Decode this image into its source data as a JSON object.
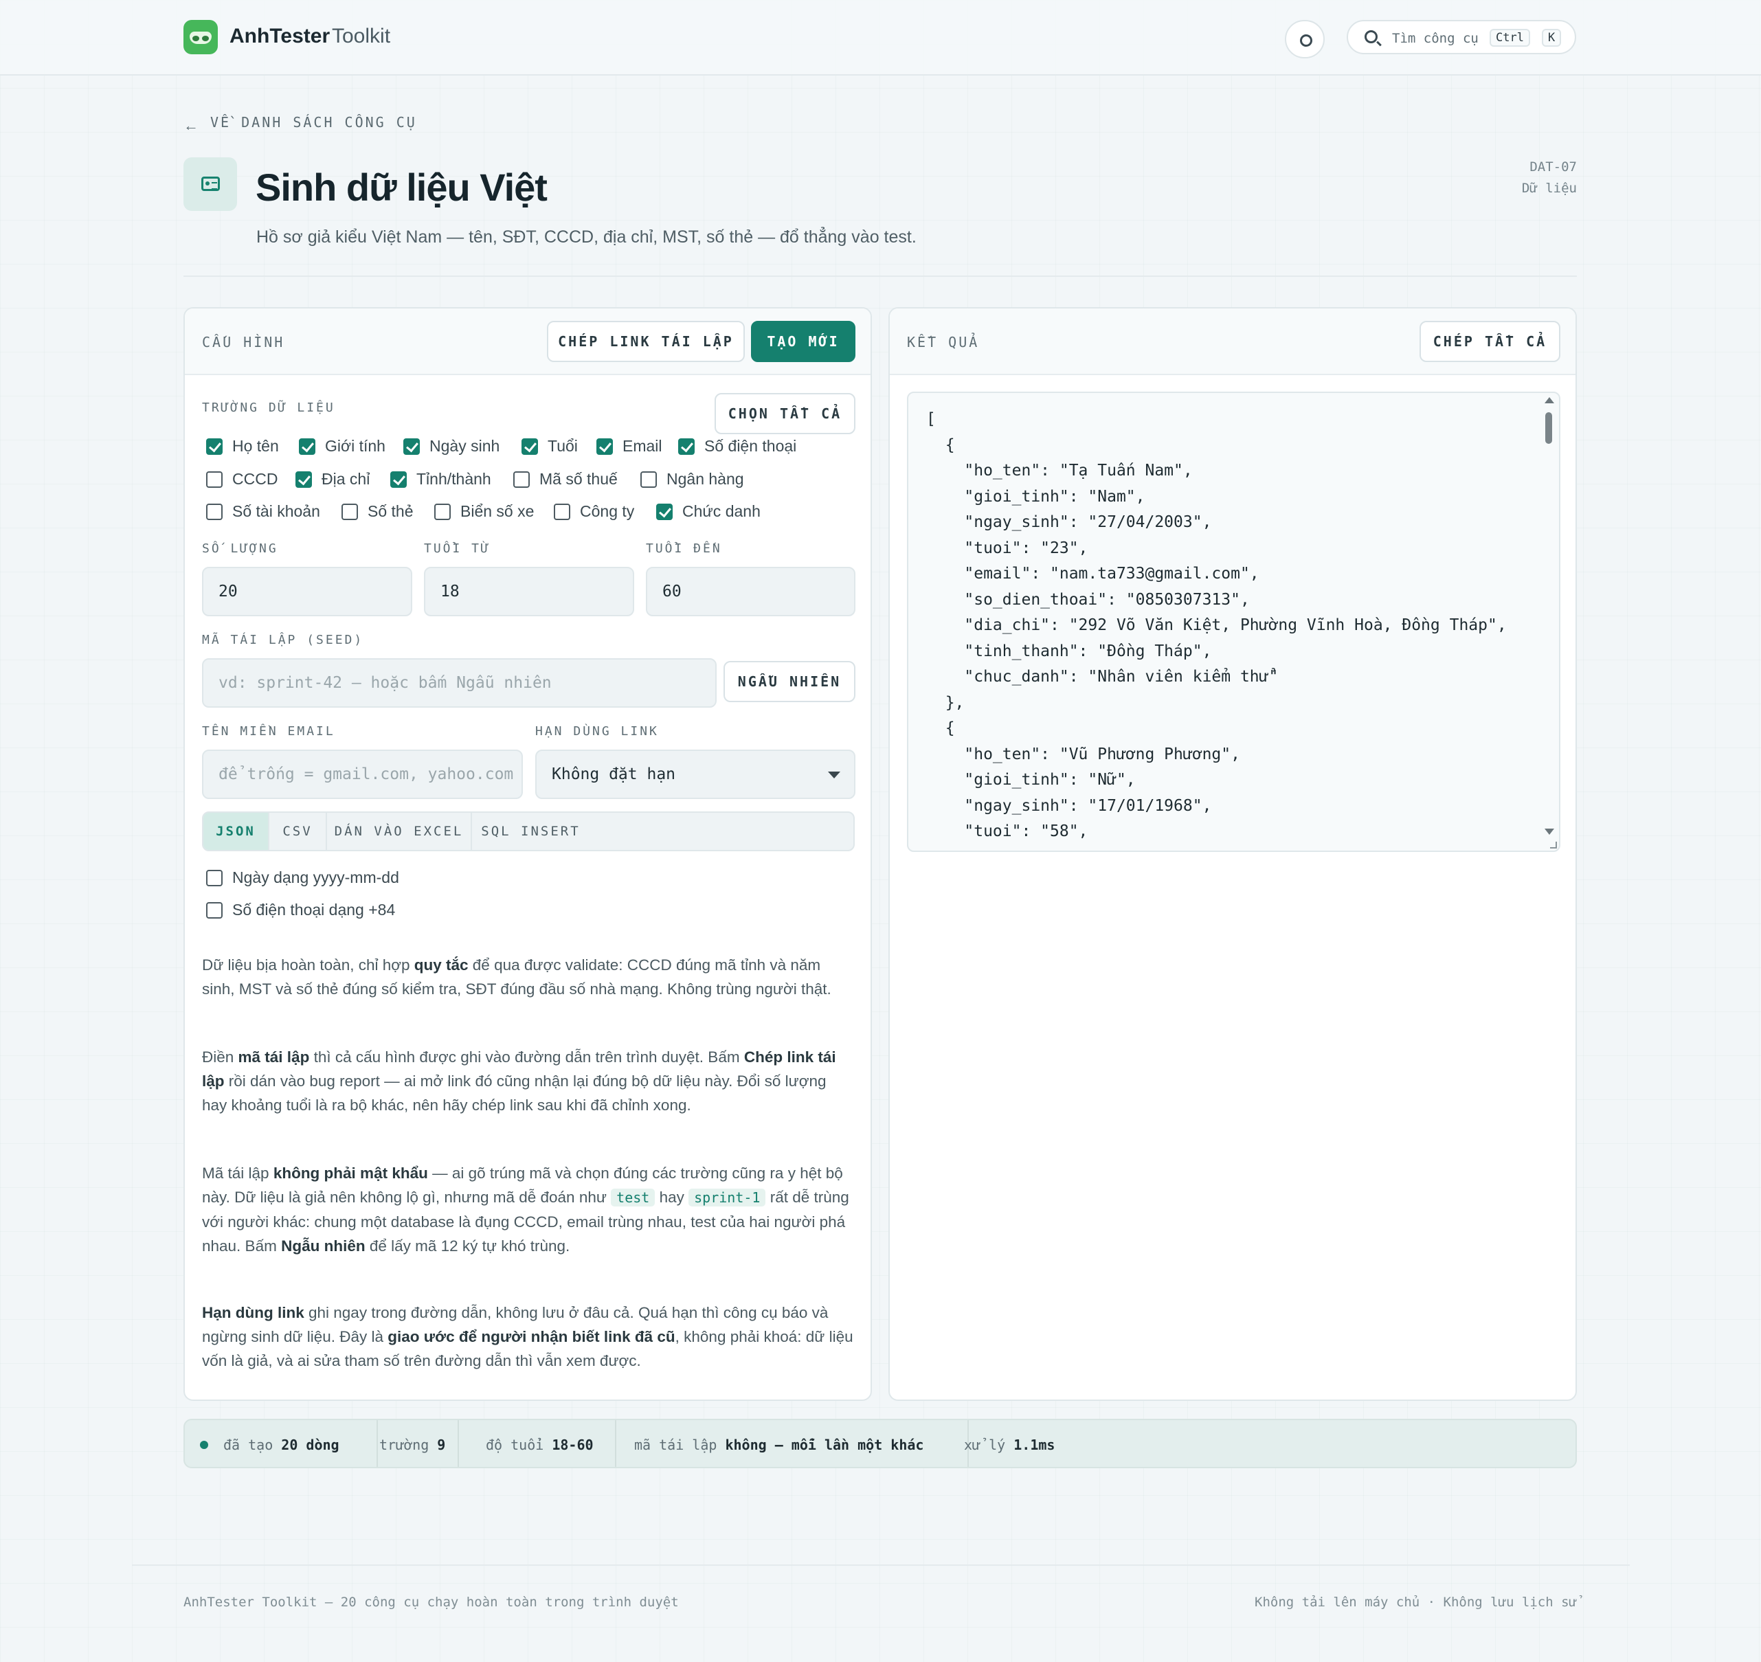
{
  "header": {
    "brand": "AnhTester",
    "brand_sub": "Toolkit",
    "search_placeholder": "Tìm công cụ",
    "kbd_ctrl": "Ctrl",
    "kbd_k": "K"
  },
  "page": {
    "back_label": "VỀ DANH SÁCH CÔNG CỤ",
    "title": "Sinh dữ liệu Việt",
    "subtitle": "Hồ sơ giả kiểu Việt Nam — tên, SĐT, CCCD, địa chỉ, MST, số thẻ — đổ thẳng vào test.",
    "code": "DAT-07",
    "category": "Dữ liệu"
  },
  "config": {
    "title": "CẤU HÌNH",
    "copy_link_button": "CHÉP LINK TÁI LẬP",
    "generate_button": "TẠO MỚI",
    "fields_label": "TRƯỜNG DỮ LIỆU",
    "select_all_button": "CHỌN TẤT CẢ",
    "fields": [
      {
        "label": "Họ tên",
        "checked": true
      },
      {
        "label": "Giới tính",
        "checked": true
      },
      {
        "label": "Ngày sinh",
        "checked": true
      },
      {
        "label": "Tuổi",
        "checked": true
      },
      {
        "label": "Email",
        "checked": true
      },
      {
        "label": "Số điện thoại",
        "checked": true
      },
      {
        "label": "CCCD",
        "checked": false
      },
      {
        "label": "Địa chỉ",
        "checked": true
      },
      {
        "label": "Tỉnh/thành",
        "checked": true
      },
      {
        "label": "Mã số thuế",
        "checked": false
      },
      {
        "label": "Ngân hàng",
        "checked": false
      },
      {
        "label": "Số tài khoản",
        "checked": false
      },
      {
        "label": "Số thẻ",
        "checked": false
      },
      {
        "label": "Biển số xe",
        "checked": false
      },
      {
        "label": "Công ty",
        "checked": false
      },
      {
        "label": "Chức danh",
        "checked": true
      }
    ],
    "count_label": "SỐ LƯỢNG",
    "count_value": "20",
    "age_from_label": "TUỔI TỪ",
    "age_from_value": "18",
    "age_to_label": "TUỔI ĐẾN",
    "age_to_value": "60",
    "seed_label": "MÃ TÁI LẬP (SEED)",
    "seed_placeholder": "vd: sprint-42 — hoặc bấm Ngẫu nhiên",
    "random_button": "NGẪU NHIÊN",
    "email_domain_label": "TÊN MIỀN EMAIL",
    "email_domain_placeholder": "để trống = gmail.com, yahoo.com",
    "link_expiry_label": "HẠN DÙNG LINK",
    "link_expiry_value": "Không đặt hạn",
    "formats": [
      {
        "label": "JSON",
        "active": true
      },
      {
        "label": "CSV",
        "active": false
      },
      {
        "label": "DÁN VÀO EXCEL",
        "active": false
      },
      {
        "label": "SQL INSERT",
        "active": false
      }
    ],
    "option_date": {
      "label": "Ngày dạng yyyy-mm-dd",
      "checked": false
    },
    "option_phone": {
      "label": "Số điện thoại dạng +84",
      "checked": false
    },
    "help": {
      "p1_a": "Dữ liệu bịa hoàn toàn, chỉ hợp ",
      "p1_b": "quy tắc",
      "p1_c": " để qua được validate: CCCD đúng mã tỉnh và năm sinh, MST và số thẻ đúng số kiểm tra, SĐT đúng đầu số nhà mạng. Không trùng người thật.",
      "p2_a": "Điền ",
      "p2_b": "mã tái lập",
      "p2_c": " thì cả cấu hình được ghi vào đường dẫn trên trình duyệt. Bấm ",
      "p2_d": "Chép link tái lập",
      "p2_e": " rồi dán vào bug report — ai mở link đó cũng nhận lại đúng bộ dữ liệu này. Đổi số lượng hay khoảng tuổi là ra bộ khác, nên hãy chép link sau khi đã chỉnh xong.",
      "p3_a": "Mã tái lập ",
      "p3_b": "không phải mật khẩu",
      "p3_c": " — ai gõ trúng mã và chọn đúng các trường cũng ra y hệt bộ này. Dữ liệu là giả nên không lộ gì, nhưng mã dễ đoán như ",
      "p3_code1": "test",
      "p3_d": " hay ",
      "p3_code2": "sprint-1",
      "p3_e": " rất dễ trùng với người khác: chung một database là đụng CCCD, email trùng nhau, test của hai người phá nhau. Bấm ",
      "p3_f": "Ngẫu nhiên",
      "p3_g": " để lấy mã 12 ký tự khó trùng.",
      "p4_a": "Hạn dùng link",
      "p4_b": " ghi ngay trong đường dẫn, không lưu ở đâu cả. Quá hạn thì công cụ báo và ngừng sinh dữ liệu. Đây là ",
      "p4_c": "giao ước để người nhận biết link đã cũ",
      "p4_d": ", không phải khoá: dữ liệu vốn là giả, và ai sửa tham số trên đường dẫn thì vẫn xem được."
    }
  },
  "result": {
    "title": "KẾT QUẢ",
    "copy_all_button": "CHÉP TẤT CẢ",
    "output": "[\n  {\n    \"ho_ten\": \"Tạ Tuấn Nam\",\n    \"gioi_tinh\": \"Nam\",\n    \"ngay_sinh\": \"27/04/2003\",\n    \"tuoi\": \"23\",\n    \"email\": \"nam.ta733@gmail.com\",\n    \"so_dien_thoai\": \"0850307313\",\n    \"dia_chi\": \"292 Võ Văn Kiệt, Phường Vĩnh Hoà, Đồng Tháp\",\n    \"tinh_thanh\": \"Đồng Tháp\",\n    \"chuc_danh\": \"Nhân viên kiểm thử\"\n  },\n  {\n    \"ho_ten\": \"Vũ Phương Phương\",\n    \"gioi_tinh\": \"Nữ\",\n    \"ngay_sinh\": \"17/01/1968\",\n    \"tuoi\": \"58\","
  },
  "status": {
    "created_label": "đã tạo",
    "created_value": "20 dòng",
    "fields_label": "trường",
    "fields_value": "9",
    "age_label": "độ tuổi",
    "age_value": "18-60",
    "seed_label": "mã tái lập",
    "seed_value": "không — mỗi lần một khác",
    "time_label": "xử lý",
    "time_value": "1.1ms"
  },
  "footer": {
    "left": "AnhTester Toolkit — 20 công cụ chạy hoàn toàn trong trình duyệt",
    "right": "Không tải lên máy chủ · Không lưu lịch sử"
  },
  "colors": {
    "accent": "#15806e",
    "logo": "#46b75a",
    "background": "#f2f6f8"
  },
  "icons": [
    "logo-icon",
    "sun-icon",
    "search-icon",
    "arrow-left-icon",
    "id-card-icon",
    "chevron-down-icon"
  ]
}
